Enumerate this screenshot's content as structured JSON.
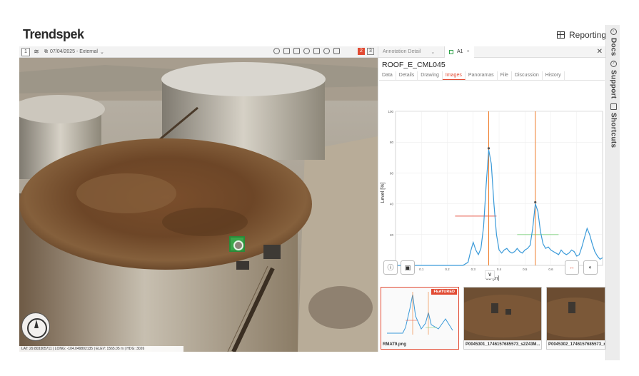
{
  "app": {
    "logo": "Trendspek",
    "reporting_label": "Reporting"
  },
  "rail": {
    "items": [
      {
        "label": "Docs"
      },
      {
        "label": "Support"
      },
      {
        "label": "Shortcuts"
      }
    ]
  },
  "viewport": {
    "layer_btn": "1",
    "date_label": "07/04/2025 - External",
    "right_a": "2",
    "right_b": "3",
    "coords": "LAT: 29.803305711 | LONG: -104.049802135 | ELEV: 1565.05 m | HDG: 3026"
  },
  "panel": {
    "tab_detail": "Annotation Detail",
    "tab_active": "A1",
    "title": "ROOF_E_CML045",
    "subtabs": [
      "Data",
      "Details",
      "Drawing",
      "Images",
      "Panoramas",
      "File",
      "Discussion",
      "History"
    ],
    "active_subtab": "Images",
    "chevron": "∨"
  },
  "chart_data": {
    "type": "line",
    "ylabel": "Level [%]",
    "xlabel": "ce [in]",
    "ylim": [
      0,
      100
    ],
    "xlim": [
      0,
      0.8
    ],
    "y_ticks": [
      "100",
      "80",
      "60",
      "40",
      "20"
    ],
    "x_ticks": [
      "0.1",
      "0.2",
      "0.3",
      "0.4",
      "0.5",
      "0.6",
      "0.7"
    ],
    "series": [
      {
        "x": [
          0.0,
          0.02,
          0.05,
          0.08,
          0.11,
          0.14,
          0.17,
          0.2,
          0.23,
          0.26,
          0.28,
          0.29,
          0.3,
          0.31,
          0.32,
          0.33,
          0.34,
          0.35,
          0.36,
          0.37,
          0.38,
          0.39,
          0.4,
          0.41,
          0.42,
          0.43,
          0.44,
          0.45,
          0.46,
          0.47,
          0.48,
          0.49,
          0.5,
          0.51,
          0.52,
          0.53,
          0.54,
          0.55,
          0.56,
          0.57,
          0.58,
          0.59,
          0.6,
          0.61,
          0.62,
          0.63,
          0.64,
          0.65,
          0.66,
          0.67,
          0.68,
          0.69,
          0.7,
          0.71,
          0.72,
          0.73,
          0.74,
          0.75,
          0.76,
          0.77,
          0.78,
          0.79,
          0.8
        ],
        "y": [
          0,
          0,
          0,
          0,
          0,
          0,
          0,
          0,
          0,
          0,
          2,
          9,
          15,
          10,
          7,
          11,
          25,
          52,
          75,
          66,
          40,
          20,
          10,
          8,
          10,
          11,
          9,
          8,
          9,
          11,
          9,
          8,
          10,
          11,
          13,
          24,
          40,
          35,
          22,
          14,
          11,
          12,
          10,
          9,
          8,
          7,
          10,
          8,
          7,
          8,
          10,
          9,
          6,
          7,
          12,
          18,
          24,
          20,
          14,
          9,
          6,
          4,
          5
        ]
      }
    ],
    "markers": [
      {
        "x": 0.36,
        "y": 76
      },
      {
        "x": 0.54,
        "y": 41
      }
    ],
    "vertical_lines": [
      0.36,
      0.54
    ],
    "horizontal_segments": [
      {
        "x0": 0.23,
        "x1": 0.39,
        "y": 32,
        "color": "#e55a4a"
      },
      {
        "x0": 0.47,
        "x1": 0.63,
        "y": 20,
        "color": "#7fd17f"
      }
    ],
    "colors": {
      "line": "#3a9ad9",
      "vline": "#ef7d2a"
    }
  },
  "thumbnails": [
    {
      "caption": "RMAT9.png",
      "badge": "FEATURED"
    },
    {
      "caption": "P0045301_1746157685573_s2Z43M..."
    },
    {
      "caption": "P0045302_1746157685573_r"
    }
  ]
}
